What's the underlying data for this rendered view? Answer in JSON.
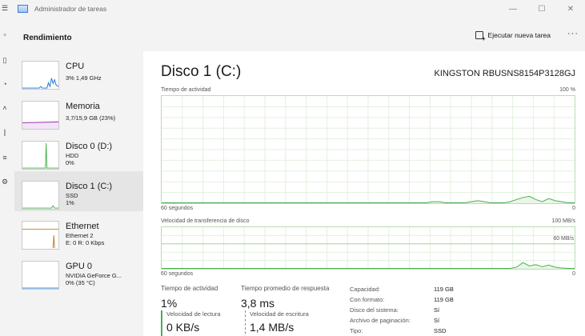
{
  "window": {
    "title": "Administrador de tareas",
    "controls": {
      "minimize": "—",
      "maximize": "☐",
      "close": "✕"
    }
  },
  "nav_rail": {
    "icons": [
      "hamburger-icon",
      "processes-icon",
      "performance-icon",
      "history-icon",
      "startup-icon",
      "users-icon",
      "details-icon",
      "services-icon"
    ]
  },
  "header": {
    "title": "Rendimiento",
    "run_task_label": "Ejecutar nueva tarea",
    "more_label": "···"
  },
  "sidebar": {
    "items": [
      {
        "name": "CPU",
        "sub1": "3% 1,49 GHz",
        "sub2": "",
        "sub3": "",
        "color": "#1878d4"
      },
      {
        "name": "Memoria",
        "sub1": "3,7/15,9 GB (23%)",
        "sub2": "",
        "sub3": "",
        "color": "#8e24aa"
      },
      {
        "name": "Disco 0 (D:)",
        "sub1": "HDD",
        "sub2": "0%",
        "sub3": "",
        "color": "#4caf50"
      },
      {
        "name": "Disco 1 (C:)",
        "sub1": "SSD",
        "sub2": "1%",
        "sub3": "",
        "color": "#4caf50"
      },
      {
        "name": "Ethernet",
        "sub1": "Ethernet 2",
        "sub2": "E: 0 R: 0 Kbps",
        "sub3": "",
        "color": "#c77a2c"
      },
      {
        "name": "GPU 0",
        "sub1": "NVIDIA GeForce G...",
        "sub2": "0% (35 °C)",
        "sub3": "",
        "color": "#1878d4"
      }
    ],
    "active_index": 3
  },
  "main": {
    "title": "Disco 1 (C:)",
    "model": "KINGSTON RBUSNS8154P3128GJ",
    "graph1": {
      "label": "Tiempo de actividad",
      "max_label": "100 %",
      "time_label": "60 segundos",
      "min_label": "0",
      "color": "#4caf50",
      "values": [
        0,
        0,
        0,
        0,
        0,
        0,
        0,
        0,
        0,
        0,
        0,
        0,
        0,
        0,
        0,
        0,
        0,
        0,
        0,
        0,
        0,
        0,
        0,
        0,
        0,
        0,
        0,
        0,
        0,
        0,
        0,
        0,
        0,
        0,
        0,
        0,
        0,
        0,
        0,
        0,
        0,
        0,
        1,
        1,
        0,
        0,
        0,
        0,
        1,
        2,
        1,
        0,
        0,
        0,
        1,
        3,
        5,
        6,
        3,
        1,
        4,
        2,
        1,
        0,
        0
      ]
    },
    "graph2": {
      "label": "Velocidad de transferencia de disco",
      "max_label": "100 MB/s",
      "secondary_label": "60 MB/s",
      "time_label": "60 segundos",
      "min_label": "0",
      "color": "#4caf50",
      "values": [
        0,
        0,
        0,
        0,
        0,
        0,
        0,
        0,
        0,
        0,
        0,
        0,
        0,
        0,
        0,
        0,
        0,
        0,
        0,
        0,
        0,
        0,
        0,
        0,
        0,
        0,
        0,
        0,
        0,
        0,
        0,
        0,
        0,
        0,
        0,
        0,
        0,
        0,
        0,
        0,
        0,
        0,
        0,
        0,
        0,
        0,
        0,
        0,
        0,
        0,
        0,
        0,
        0,
        0,
        0,
        3,
        14,
        6,
        9,
        4,
        8,
        3,
        1,
        0,
        0
      ]
    },
    "stats": {
      "active_time_label": "Tiempo de actividad",
      "active_time_value": "1%",
      "response_label": "Tiempo promedio de respuesta",
      "response_value": "3,8 ms",
      "read_label": "Velocidad de lectura",
      "read_value": "0 KB/s",
      "write_label": "Velocidad de escritura",
      "write_value": "1,4 MB/s"
    },
    "properties": [
      {
        "key": "Capacidad:",
        "value": "119 GB"
      },
      {
        "key": "Con formato:",
        "value": "119 GB"
      },
      {
        "key": "Disco del sistema:",
        "value": "Sí"
      },
      {
        "key": "Archivo de paginación:",
        "value": "Sí"
      },
      {
        "key": "Tipo:",
        "value": "SSD"
      }
    ]
  }
}
